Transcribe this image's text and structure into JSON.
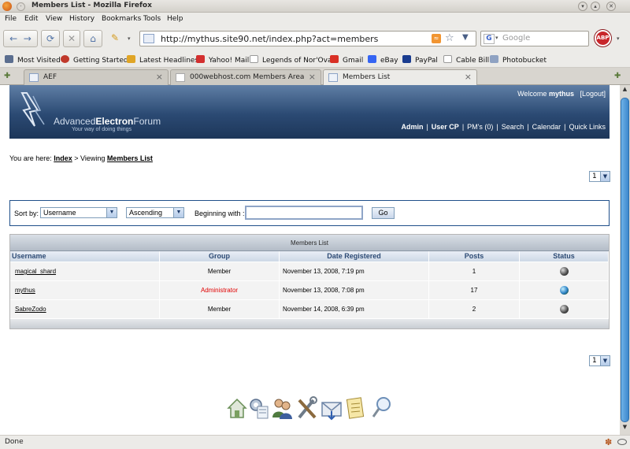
{
  "window": {
    "title": "Members List - Mozilla Firefox",
    "menu_glyph": "·"
  },
  "menubar": [
    "File",
    "Edit",
    "View",
    "History",
    "Bookmarks",
    "Tools",
    "Help"
  ],
  "nav": {
    "back_icon": "arrow-left-icon",
    "url": "http://mythus.site90.net/index.php?act=members",
    "search_placeholder": "Google",
    "search_engine_glyph": "G",
    "abp_label": "ABP"
  },
  "bookmarks": [
    {
      "label": "Most Visited",
      "color": "#5b6e8f"
    },
    {
      "label": "Getting Started",
      "color": "#c0392b"
    },
    {
      "label": "Latest Headlines",
      "color": "#e0a526"
    },
    {
      "label": "Yahoo! Mail",
      "color": "#d32f2f"
    },
    {
      "label": "Legends of Nor'Ova",
      "color": "#ffffff"
    },
    {
      "label": "Gmail",
      "color": "#d93025"
    },
    {
      "label": "eBay",
      "color": "#3665f3"
    },
    {
      "label": "PayPal",
      "color": "#1a3c8f"
    },
    {
      "label": "Cable Bill",
      "color": "#ffffff"
    },
    {
      "label": "Photobucket",
      "color": "#8fa2c2"
    }
  ],
  "tabs": [
    {
      "label": "AEF"
    },
    {
      "label": "000webhost.com Members Area"
    },
    {
      "label": "Members List"
    }
  ],
  "banner": {
    "brand_plain": "Advanced",
    "brand_bold": "Electron",
    "brand_tail": "Forum",
    "tagline": "Your way of doing things",
    "welcome_prefix": "Welcome",
    "username": "mythus",
    "logout": "[Logout]",
    "links": {
      "admin": "Admin",
      "usercp": "User CP",
      "pms": "PM's (0)",
      "search": "Search",
      "calendar": "Calendar",
      "quicklinks": "Quick Links",
      "separator": "|"
    }
  },
  "breadcrumb": {
    "prefix": "You are here:",
    "index": "Index",
    "middle": "> Viewing",
    "current": "Members List"
  },
  "pager": {
    "value": "1",
    "arrow": "▼"
  },
  "sort": {
    "sortby_label": "Sort by:",
    "sortby_value": "Username",
    "order_value": "Ascending",
    "begin_label": "Beginning with :",
    "begin_value": "",
    "go_label": "Go"
  },
  "members": {
    "title": "Members List",
    "columns": [
      "Username",
      "Group",
      "Date Registered",
      "Posts",
      "Status"
    ],
    "rows": [
      {
        "username": "magical_shard",
        "group": "Member",
        "date": "November 13, 2008, 7:19 pm",
        "posts": "1",
        "online": false
      },
      {
        "username": "mythus",
        "group": "Administrator",
        "date": "November 13, 2008, 7:08 pm",
        "posts": "17",
        "online": true
      },
      {
        "username": "SabreZodo",
        "group": "Member",
        "date": "November 14, 2008, 6:39 pm",
        "posts": "2",
        "online": false
      }
    ]
  },
  "footer_icons": [
    "home-icon",
    "settings-icon",
    "users-icon",
    "tools-icon",
    "mail-icon",
    "notes-icon",
    "search-icon"
  ],
  "status": {
    "text": "Done"
  },
  "colors": {
    "admin": "#e00000",
    "banner_dark": "#1d3659",
    "scroll_thumb": "#3c87cc"
  }
}
